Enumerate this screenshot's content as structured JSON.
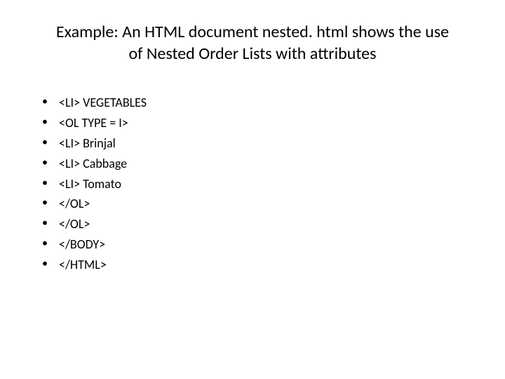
{
  "title": "Example: An HTML document nested. html shows the use of Nested Order Lists with attributes",
  "lines": [
    "<LI> VEGETABLES",
    "<OL TYPE = I>",
    "<LI> Brinjal",
    "<LI> Cabbage",
    "<LI> Tomato",
    "</OL>",
    "</OL>",
    "</BODY>",
    "</HTML>"
  ]
}
